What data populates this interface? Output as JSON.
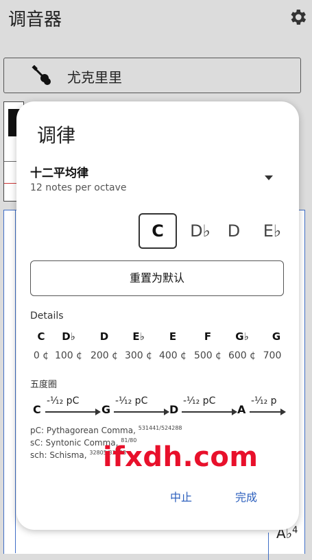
{
  "app": {
    "title": "调音器"
  },
  "instrument": {
    "label": "尤克里里",
    "icon": "guitar-icon"
  },
  "background": {
    "note": "A♭",
    "octave": "4"
  },
  "dialog": {
    "title": "调律",
    "temperament": {
      "name": "十二平均律",
      "subtitle": "12 notes per octave"
    },
    "root_notes": [
      {
        "label": "C",
        "selected": true
      },
      {
        "label": "D♭",
        "selected": false
      },
      {
        "label": "D",
        "selected": false
      },
      {
        "label": "E♭",
        "selected": false
      }
    ],
    "reset_button": "重置为默认",
    "details": {
      "label": "Details",
      "notes": [
        "C",
        "D♭",
        "D",
        "E♭",
        "E",
        "F",
        "G♭",
        "G"
      ],
      "cents": [
        "0 ¢",
        "100 ¢",
        "200 ¢",
        "300 ¢",
        "400 ¢",
        "500 ¢",
        "600 ¢",
        "700"
      ]
    },
    "circle_of_fifths": {
      "label": "五度圈",
      "notes": [
        "C",
        "G",
        "D",
        "A"
      ],
      "arrow_label": "-¹⁄₁₂ pC",
      "arrow_label_cut": "-¹⁄₁₂ p"
    },
    "footnotes": [
      {
        "text": "pC: Pythagorean Comma, ",
        "ratio": "531441/524288"
      },
      {
        "text": "sC: Syntonic Comma, ",
        "ratio": "81/80"
      },
      {
        "text": "sch: Schisma, ",
        "ratio": "32805/32768"
      }
    ],
    "cancel_button": "中止",
    "confirm_button": "完成"
  },
  "watermark": "ifxdh.com",
  "colors": {
    "accent": "#2c5fbd",
    "watermark": "#e8102b",
    "panel_border": "#3f6ec6"
  }
}
